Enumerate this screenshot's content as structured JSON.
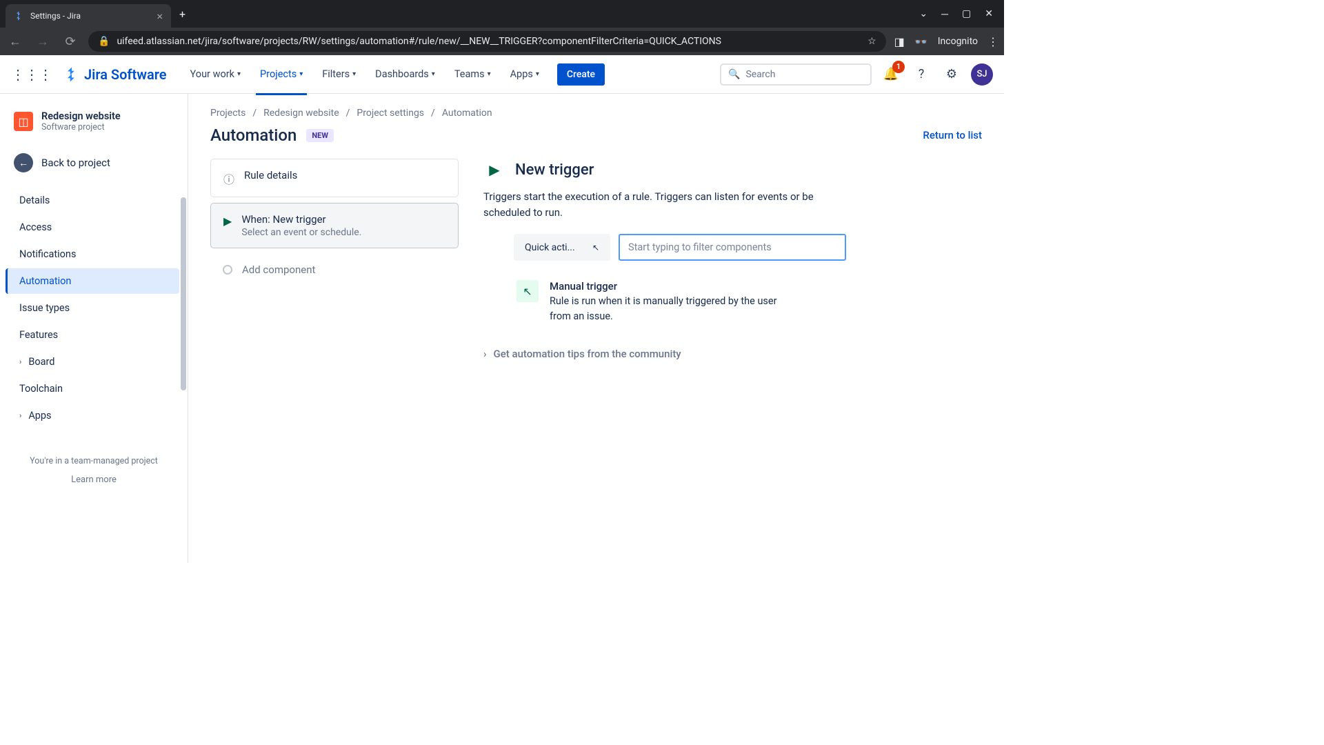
{
  "browser": {
    "tab_title": "Settings - Jira",
    "url": "uifeed.atlassian.net/jira/software/projects/RW/settings/automation#/rule/new/__NEW__TRIGGER?componentFilterCriteria=QUICK_ACTIONS",
    "incognito": "Incognito"
  },
  "header": {
    "product": "Jira Software",
    "nav": {
      "your_work": "Your work",
      "projects": "Projects",
      "filters": "Filters",
      "dashboards": "Dashboards",
      "teams": "Teams",
      "apps": "Apps"
    },
    "create": "Create",
    "search_placeholder": "Search",
    "notification_count": "1",
    "avatar_initials": "SJ"
  },
  "sidebar": {
    "project_name": "Redesign website",
    "project_type": "Software project",
    "back": "Back to project",
    "items": {
      "details": "Details",
      "access": "Access",
      "notifications": "Notifications",
      "automation": "Automation",
      "issue_types": "Issue types",
      "features": "Features",
      "board": "Board",
      "toolchain": "Toolchain",
      "apps": "Apps"
    },
    "footer": "You're in a team-managed project",
    "learn_more": "Learn more"
  },
  "breadcrumb": {
    "projects": "Projects",
    "project": "Redesign website",
    "settings": "Project settings",
    "automation": "Automation"
  },
  "page": {
    "title": "Automation",
    "new_badge": "NEW",
    "return": "Return to list"
  },
  "rule": {
    "details": "Rule details",
    "when_title": "When: New trigger",
    "when_sub": "Select an event or schedule.",
    "add_component": "Add component"
  },
  "detail": {
    "title": "New trigger",
    "desc": "Triggers start the execution of a rule. Triggers can listen for events or be scheduled to run.",
    "quick_actions": "Quick acti...",
    "filter_placeholder": "Start typing to filter components",
    "manual_name": "Manual trigger",
    "manual_desc": "Rule is run when it is manually triggered by the user from an issue.",
    "tips": "Get automation tips from the community"
  }
}
